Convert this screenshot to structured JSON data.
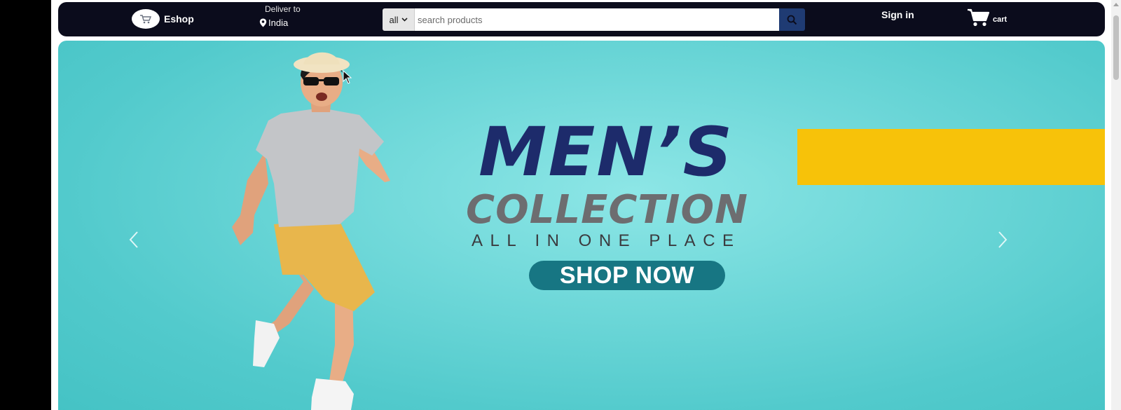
{
  "navbar": {
    "brand": "Eshop",
    "logo_icon": "cart-logo-icon",
    "deliver_label": "Deliver to",
    "deliver_location": "India",
    "search": {
      "category": "all",
      "placeholder": "search products"
    },
    "signin_label": "Sign in",
    "cart_label": "cart"
  },
  "hero": {
    "title_line1": "MEN’S",
    "title_line2": "COLLECTION",
    "subtitle": "ALL IN ONE PLACE",
    "cta_label": "SHOP NOW",
    "prev_icon": "chevron-left-icon",
    "next_icon": "chevron-right-icon"
  },
  "colors": {
    "navbar_bg": "#0b0c1c",
    "hero_bg": "#6fd8d9",
    "title_navy": "#1d2b6b",
    "title_gray": "#6d6d70",
    "accent_yellow": "#f7c209",
    "cta_teal": "#177683",
    "search_button": "#1f3b73"
  }
}
